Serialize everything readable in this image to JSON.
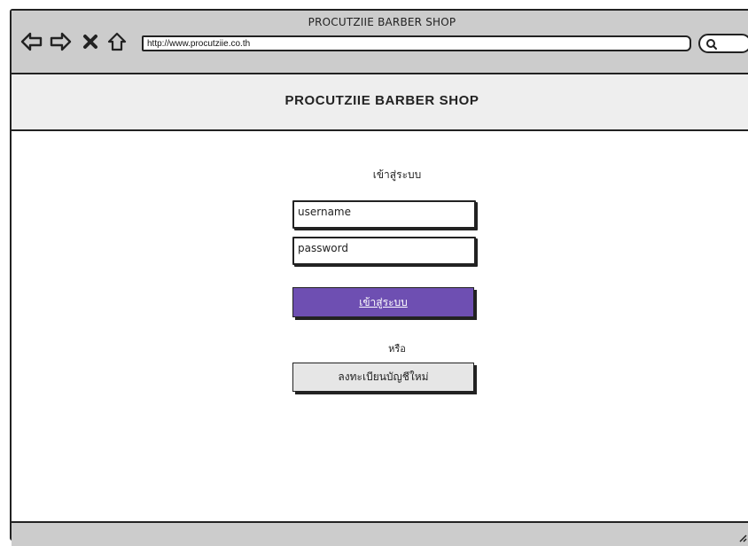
{
  "window": {
    "title": "PROCUTZIIE BARBER SHOP",
    "url": "http://www.procutziie.co.th"
  },
  "toolbar": {
    "icons": [
      "back-arrow-icon",
      "forward-arrow-icon",
      "close-icon",
      "home-icon",
      "search-icon"
    ]
  },
  "header": {
    "title": "PROCUTZIIE BARBER SHOP"
  },
  "login": {
    "heading": "เข้าสู่ระบบ",
    "username_value": "username",
    "password_value": "password",
    "submit_label": "เข้าสู่ระบบ",
    "or_text": "หรือ",
    "register_label": "ลงทะเบียนบัญชีใหม่"
  },
  "colors": {
    "primary": "#6e4fb2",
    "chrome": "#cccccc",
    "header_bg": "#eeeeee"
  }
}
